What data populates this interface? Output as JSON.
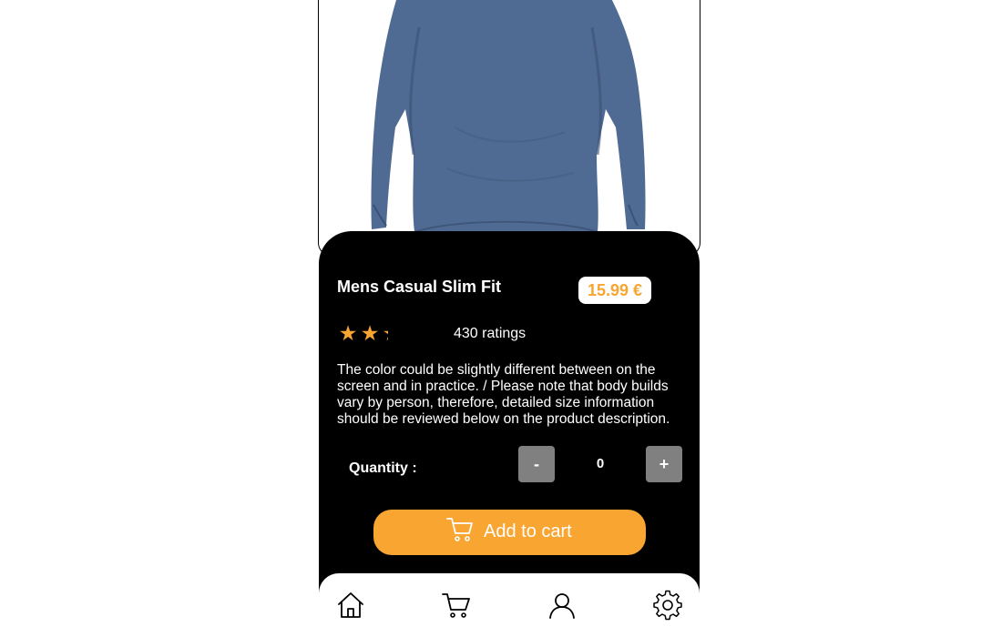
{
  "product": {
    "title": "Mens Casual Slim Fit",
    "price": "15.99 €",
    "rating_value": 2.2,
    "rating_max": 5,
    "ratings_count_label": "430 ratings",
    "description": "The color could be slightly different between on the screen and in practice. / Please note that body builds vary by person, therefore, detailed size information should be reviewed below on the product description."
  },
  "quantity": {
    "label": "Quantity :",
    "minus_label": "-",
    "value": "0",
    "plus_label": "+"
  },
  "cart_button": {
    "label": "Add to cart",
    "icon": "cart-icon"
  },
  "nav": {
    "items": [
      {
        "icon": "home-icon"
      },
      {
        "icon": "cart-icon"
      },
      {
        "icon": "user-icon"
      },
      {
        "icon": "gear-icon"
      }
    ]
  },
  "colors": {
    "accent": "#f8a531",
    "panel": "#000000",
    "shirt": "#4f6a93",
    "button_gray": "#808080"
  }
}
